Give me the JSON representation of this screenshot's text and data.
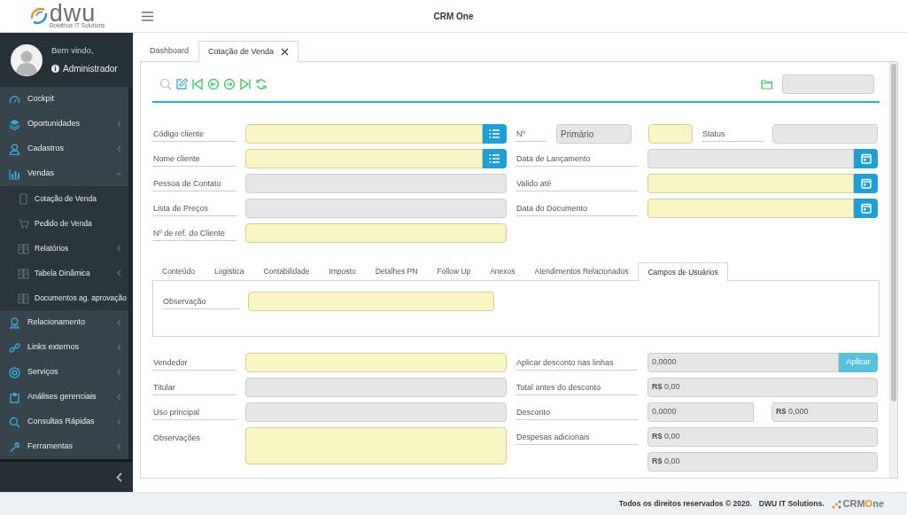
{
  "header": {
    "logo": {
      "text": "dwu",
      "tagline": "Dowithus IT Solutions"
    },
    "title": "CRM One"
  },
  "user": {
    "greeting": "Bem vindo,",
    "name": "Administrador"
  },
  "sidebar": {
    "items": [
      {
        "label": "Cockpit"
      },
      {
        "label": "Oportunidades",
        "expanded": false
      },
      {
        "label": "Cadastros",
        "expanded": false
      },
      {
        "label": "Vendas",
        "expanded": true,
        "children": [
          {
            "label": "Cotação de Venda"
          },
          {
            "label": "Pedido de Venda"
          },
          {
            "label": "Relatórios",
            "expanded": false
          },
          {
            "label": "Tabela Dinâmica",
            "expanded": false
          },
          {
            "label": "Documentos ag. aprovação"
          }
        ]
      },
      {
        "label": "Relacionamento",
        "expanded": false
      },
      {
        "label": "Links externos",
        "expanded": false
      },
      {
        "label": "Serviços",
        "expanded": false
      },
      {
        "label": "Análises gerenciais",
        "expanded": false
      },
      {
        "label": "Consultas Rápidas",
        "expanded": false
      },
      {
        "label": "Ferramentas",
        "expanded": false
      }
    ]
  },
  "tabs": [
    {
      "label": "Dashboard",
      "selected": false,
      "closable": false
    },
    {
      "label": "Cotação de Venda",
      "selected": true,
      "closable": true
    }
  ],
  "toolbar": {
    "series_select": {
      "disabled": true
    }
  },
  "header_fields": {
    "left": [
      {
        "label": "Código cliente",
        "kind": "input-list",
        "disabled": false
      },
      {
        "label": "Nome cliente",
        "kind": "input-list",
        "disabled": false
      },
      {
        "label": "Pessoa de Contato",
        "kind": "select",
        "disabled": true
      },
      {
        "label": "Lista de Preços",
        "kind": "select",
        "disabled": true
      },
      {
        "label": "Nº de ref. do Cliente",
        "kind": "input",
        "disabled": false
      }
    ],
    "right": [
      {
        "label": "Nº",
        "kind": "number",
        "series": {
          "value": "Primário",
          "disabled": true
        },
        "number": {
          "disabled": false
        },
        "status_label": "Status",
        "status": {
          "disabled": true
        }
      },
      {
        "label": "Data de Lançamento",
        "kind": "date",
        "disabled": true
      },
      {
        "label": "Valido até",
        "kind": "date",
        "disabled": false
      },
      {
        "label": "Data do Documento",
        "kind": "date",
        "disabled": false
      }
    ]
  },
  "detail_tabs": [
    {
      "label": "Conteúdo",
      "selected": false
    },
    {
      "label": "Logistica",
      "selected": false
    },
    {
      "label": "Contabilidade",
      "selected": false
    },
    {
      "label": "Imposto",
      "selected": false
    },
    {
      "label": "Detalhes PN",
      "selected": false
    },
    {
      "label": "Follow Up",
      "selected": false
    },
    {
      "label": "Anexos",
      "selected": false
    },
    {
      "label": "Atendimentos Relacionados",
      "selected": false
    },
    {
      "label": "Campos de Usuários",
      "selected": true
    }
  ],
  "detail_fields": [
    {
      "label": "Observação",
      "kind": "input",
      "disabled": false
    }
  ],
  "footer_fields": {
    "left": [
      {
        "label": "Vendedor",
        "kind": "select",
        "disabled": false
      },
      {
        "label": "Titular",
        "kind": "select",
        "disabled": true
      },
      {
        "label": "Uso principal",
        "kind": "select",
        "disabled": true
      },
      {
        "label": "Observações",
        "kind": "textarea",
        "disabled": false
      }
    ],
    "right": [
      {
        "label": "Aplicar desconto nas linhas",
        "kind": "input-button",
        "value": "0,0000",
        "button": "Aplicar",
        "disabled": true
      },
      {
        "label": "Total antes do desconto",
        "kind": "input",
        "value": "**R$** 0,00",
        "disabled": true
      },
      {
        "label": "Desconto",
        "kind": "pair",
        "values": [
          "0,0000",
          "**R$** 0,000"
        ],
        "disabled": true
      },
      {
        "label": "Despesas adicionais",
        "kind": "input",
        "value": "**R$** 0,00",
        "disabled": true
      },
      {
        "kind": "input",
        "value": "**R$** 0,00",
        "disabled": true
      }
    ]
  },
  "footer": {
    "copyright": "Todos os direitos reservados © 2020.",
    "company": "DWU IT Solutions.",
    "brand": [
      {
        "text": "CRM"
      },
      {
        "text": "O",
        "color": "#f0901e"
      },
      {
        "text": "ne"
      }
    ]
  }
}
